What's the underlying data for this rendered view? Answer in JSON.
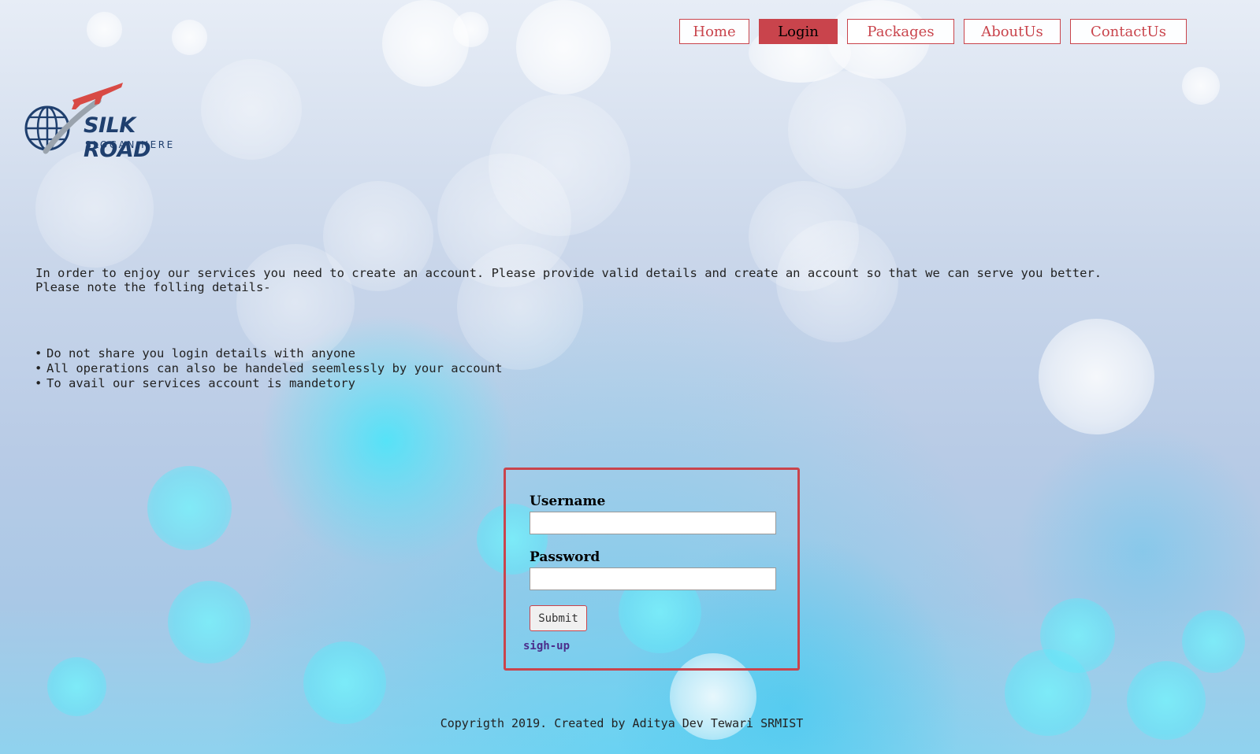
{
  "nav": {
    "items": [
      {
        "label": "Home",
        "active": false
      },
      {
        "label": "Login",
        "active": true
      },
      {
        "label": "Packages",
        "active": false
      },
      {
        "label": "AboutUs",
        "active": false
      },
      {
        "label": "ContactUs",
        "active": false
      }
    ]
  },
  "logo": {
    "title": "SILK ROAD",
    "slogan": "SLOGAN HERE"
  },
  "intro": {
    "line1": "In order to enjoy our services you need to create an account. Please provide valid details and create an account so that we can serve you better.",
    "line2": "Please note the folling details-"
  },
  "notes": [
    "Do not share you login details with anyone",
    "All operations can also be handeled seemlessly by your account",
    "To avail our services account is mandetory"
  ],
  "login": {
    "username_label": "Username",
    "username_value": "",
    "password_label": "Password",
    "password_value": "",
    "submit_label": "Submit",
    "signup_label": "sigh-up"
  },
  "footer": {
    "text": "Copyrigth 2019. Created by Aditya Dev Tewari SRMIST"
  },
  "colors": {
    "accent": "#c9444c",
    "logo_text": "#1f3f6e",
    "link": "#4b2c8a"
  }
}
